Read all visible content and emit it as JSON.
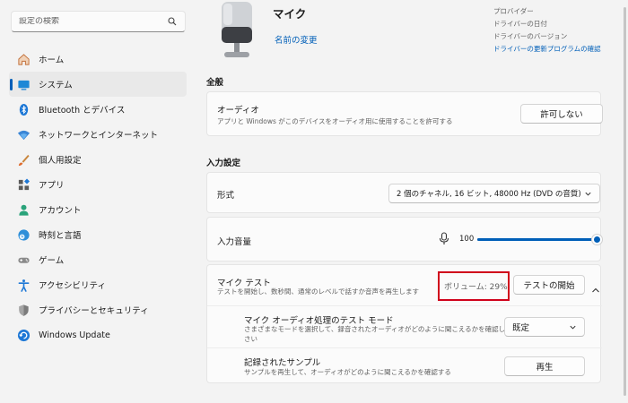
{
  "search": {
    "placeholder": "設定の検索"
  },
  "sidebar": {
    "items": [
      {
        "label": "ホーム",
        "icon": "home-icon"
      },
      {
        "label": "システム",
        "icon": "system-icon",
        "active": true
      },
      {
        "label": "Bluetooth とデバイス",
        "icon": "bluetooth-icon"
      },
      {
        "label": "ネットワークとインターネット",
        "icon": "wifi-icon"
      },
      {
        "label": "個人用設定",
        "icon": "brush-icon"
      },
      {
        "label": "アプリ",
        "icon": "apps-icon"
      },
      {
        "label": "アカウント",
        "icon": "account-icon"
      },
      {
        "label": "時刻と言語",
        "icon": "globe-clock-icon"
      },
      {
        "label": "ゲーム",
        "icon": "gamepad-icon"
      },
      {
        "label": "アクセシビリティ",
        "icon": "accessibility-icon"
      },
      {
        "label": "プライバシーとセキュリティ",
        "icon": "shield-icon"
      },
      {
        "label": "Windows Update",
        "icon": "update-icon"
      }
    ]
  },
  "device": {
    "title": "マイク",
    "rename": "名前の変更",
    "props": {
      "provider": "プロバイダー",
      "driver_date": "ドライバーの日付",
      "driver_version": "ドライバーのバージョン",
      "driver_update": "ドライバーの更新プログラムの確認"
    }
  },
  "general": {
    "section_title": "全般",
    "audio": {
      "title": "オーディオ",
      "desc": "アプリと Windows がこのデバイスをオーディオ用に使用することを許可する",
      "button": "許可しない"
    }
  },
  "input": {
    "section_title": "入力設定",
    "format": {
      "title": "形式",
      "value": "2 個のチャネル, 16 ビット, 48000 Hz (DVD の音質)"
    },
    "volume": {
      "title": "入力音量",
      "value": "100",
      "level": 1.0
    },
    "mic_test": {
      "title": "マイク テスト",
      "desc": "テストを開始し、数秒間、通常のレベルで話すか音声を再生します",
      "volume_readout": "ボリューム: 29%",
      "button": "テストの開始"
    },
    "processing": {
      "title": "マイク オーディオ処理のテスト モード",
      "desc_line1": "さまざまなモードを選択して、録音されたオーディオがどのように聞こえるかを確認してくだ",
      "desc_line2": "さい",
      "value": "既定"
    },
    "sample": {
      "title": "記録されたサンプル",
      "desc": "サンプルを再生して、オーディオがどのように聞こえるかを確認する",
      "button": "再生"
    }
  },
  "colors": {
    "accent": "#005fb8",
    "highlight": "#d0021b"
  }
}
